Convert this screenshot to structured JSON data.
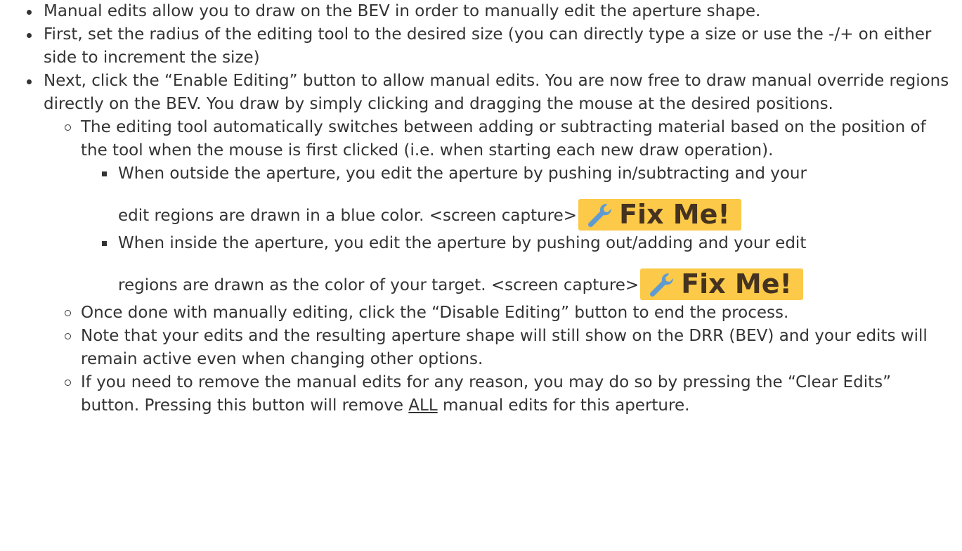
{
  "items": [
    {
      "text": "Manual edits allow you to draw on the BEV in order to manually edit the aperture shape."
    },
    {
      "text": "First, set the radius of the editing tool to the desired size (you can directly type a size or use the -/+ on either side to increment the size)"
    },
    {
      "text": "Next, click the “Enable Editing” button to allow manual edits. You are now free to draw manual override regions directly on the BEV. You draw by simply clicking and dragging the mouse at the desired positions.",
      "children": [
        {
          "text": "The editing tool automatically switches between adding or subtracting material based on the position of the tool when the mouse is first clicked (i.e. when starting each new draw operation).",
          "children": [
            {
              "line1": "When outside the aperture, you edit the aperture by pushing in/subtracting and your",
              "line2": "edit regions are drawn in a blue color. <screen capture>",
              "badge": "Fix Me!"
            },
            {
              "line1": "When inside the aperture, you edit the aperture by pushing out/adding and your edit",
              "line2": "regions are drawn as the color of your target. <screen capture>",
              "badge": "Fix Me!"
            }
          ]
        },
        {
          "text": "Once done with manually editing, click the “Disable Editing” button to end the process."
        },
        {
          "text": "Note that your edits and the resulting aperture shape will still show on the DRR (BEV) and your edits will remain active even when changing other options."
        },
        {
          "text_before": "If you need to remove the manual edits for any reason, you may do so by pressing the “Clear Edits” button. Pressing this button will remove ",
          "underlined": "ALL",
          "text_after": " manual edits for this aperture."
        }
      ]
    }
  ],
  "icons": {
    "badge_icon": "wrench-icon"
  },
  "colors": {
    "text": "#333333",
    "badge_background": "#fcc948",
    "badge_text": "#453321",
    "wrench": "#5f9bd2"
  }
}
